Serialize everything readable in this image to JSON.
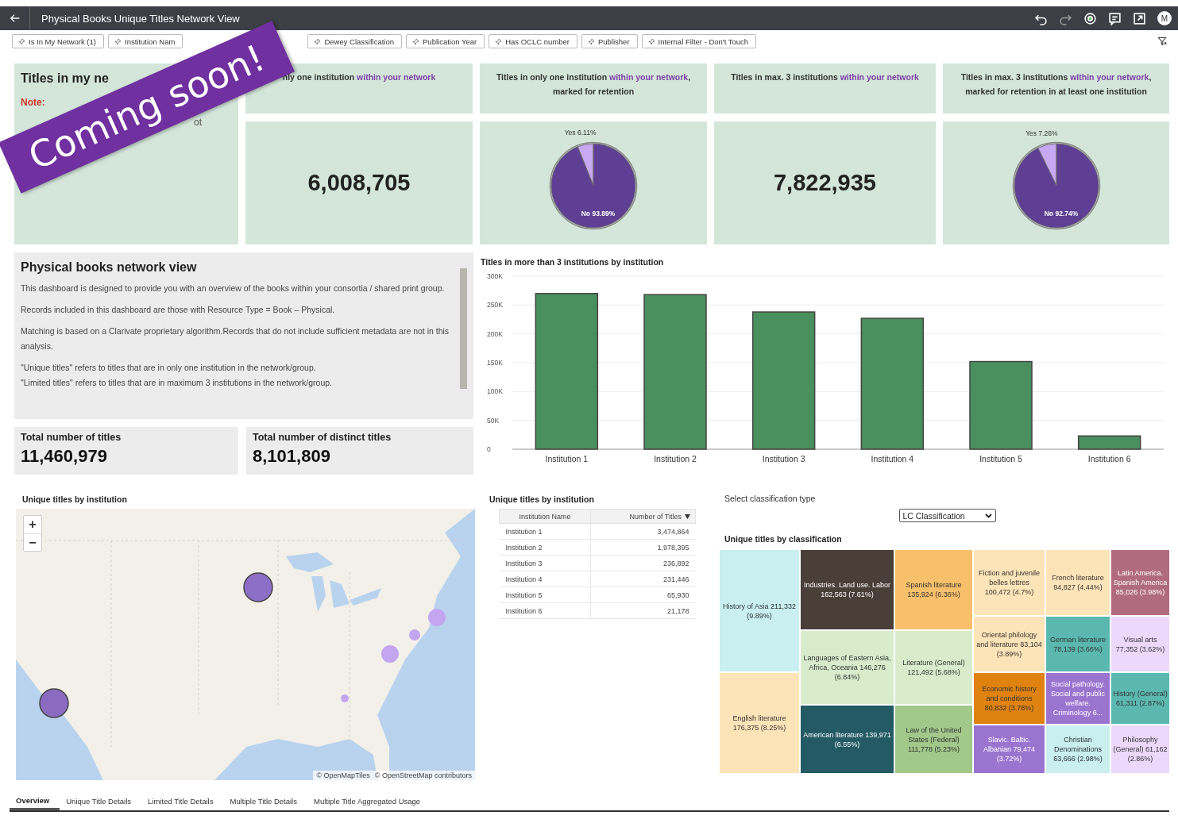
{
  "window": {
    "title": "Physical Books Unique Titles Network View",
    "avatar": "M"
  },
  "filters": [
    {
      "label": "Is In My Network (1)"
    },
    {
      "label": "Institution Nam"
    },
    {
      "label": "Dewey Classification"
    },
    {
      "label": "Publication Year"
    },
    {
      "label": "Has OCLC number"
    },
    {
      "label": "Publisher"
    },
    {
      "label": "Internal Filter - Don't Touch"
    }
  ],
  "summary_card": {
    "title": "Titles in my ne",
    "note_label": "Note:",
    "note_fragment": "ot"
  },
  "kpis": [
    {
      "kind": "number",
      "title": "nly one institution",
      "highlight": "within your network",
      "value": "6,008,705"
    },
    {
      "kind": "pie",
      "title": "Titles in only one institution",
      "highlight": "within your network",
      "title_end": ", marked for retention",
      "chart_data": {
        "type": "pie",
        "categories": [
          "Yes",
          "No"
        ],
        "values": [
          6.11,
          93.89
        ],
        "value_labels": [
          "6.11%",
          "93.89%"
        ]
      }
    },
    {
      "kind": "number",
      "title": "Titles in max. 3 institutions",
      "highlight": "within your network",
      "value": "7,822,935"
    },
    {
      "kind": "pie",
      "title": "Titles in max. 3 institutions",
      "highlight": "within your network",
      "title_end": ", marked for retention in at least one institution",
      "chart_data": {
        "type": "pie",
        "categories": [
          "Yes",
          "No"
        ],
        "values": [
          7.26,
          92.74
        ],
        "value_labels": [
          "7.26%",
          "92.74%"
        ]
      }
    }
  ],
  "info": {
    "title": "Physical books network view",
    "paragraphs": [
      "This dashboard is designed to provide you with an overview of the books within your consortia / shared print group.",
      "Records included in this dashboard are those with Resource Type = Book – Physical.",
      "Matching is based on a Clarivate proprietary algorithm.Records that do not include sufficient metadata are not in this analysis.",
      "\"Unique titles\" refers to titles that are in only one institution in the network/group.",
      "\"Limited titles\" refers to titles that are in maximum 3 institutions in the network/group."
    ]
  },
  "totals": [
    {
      "label": "Total number of titles",
      "value": "11,460,979"
    },
    {
      "label": "Total number of distinct titles",
      "value": "8,101,809"
    }
  ],
  "bar_chart": {
    "chart_data": {
      "type": "bar",
      "title": "Titles in more than 3 institutions by institution",
      "categories": [
        "Institution 1",
        "Institution 2",
        "Institution 3",
        "Institution 4",
        "Institution 5",
        "Institution 6"
      ],
      "grid": true,
      "series": [
        {
          "color": "#4a8f5e",
          "values": [
            270000,
            268000,
            238000,
            227000,
            152000,
            23000
          ]
        }
      ],
      "ylim": [
        0,
        300000
      ],
      "yticks": [
        {
          "value": 0,
          "label": "0"
        },
        {
          "value": 50000,
          "label": "50K"
        },
        {
          "value": 100000,
          "label": "100K"
        },
        {
          "value": 150000,
          "label": "150K"
        },
        {
          "value": 200000,
          "label": "200K"
        },
        {
          "value": 250000,
          "label": "250K"
        },
        {
          "value": 300000,
          "label": "300K"
        }
      ]
    }
  },
  "map": {
    "title": "Unique titles by institution",
    "zoom_in": "+",
    "zoom_out": "−",
    "attribution": [
      "© OpenMapTiles",
      "© OpenStreetMap contributors"
    ]
  },
  "table": {
    "title": "Unique titles by institution",
    "columns": [
      {
        "label": "Institution Name"
      },
      {
        "label": "Number of Titles",
        "sorted": true
      }
    ],
    "rows": [
      [
        "Institution 1",
        "3,474,864"
      ],
      [
        "Institution 2",
        "1,978,395"
      ],
      [
        "Institution 3",
        "236,892"
      ],
      [
        "Institution 4",
        "231,446"
      ],
      [
        "Institution 5",
        "65,930"
      ],
      [
        "Institution 6",
        "21,178"
      ]
    ]
  },
  "classification": {
    "label": "Select classification type",
    "value": "LC Classification"
  },
  "treemap": {
    "title": "Unique titles by classification",
    "tiles": [
      {
        "label": "History of Asia 211,332 (9.89%)",
        "color": "#c9eff0"
      },
      {
        "label": "English literature 176,375 (8.25%)",
        "color": "#fde4b8"
      },
      {
        "label": "Industries. Land use. Labor 162,563 (7.61%)",
        "color": "#4a3f38"
      },
      {
        "label": "Languages of Eastern Asia, Africa, Oceania 146,276 (6.84%)",
        "color": "#d8eccc"
      },
      {
        "label": "American literature 139,971 (6.55%)",
        "color": "#235a63"
      },
      {
        "label": "Spanish literature 135,924 (6.36%)",
        "color": "#f8c06a"
      },
      {
        "label": "Literature (General) 121,492 (5.68%)",
        "color": "#d8eccc"
      },
      {
        "label": "Law of the United States (Federal) 111,778 (5.23%)",
        "color": "#a2c98a"
      },
      {
        "label": "Fiction and juvenile belles lettres 100,472 (4.7%)",
        "color": "#fde4b8"
      },
      {
        "label": "French literature 94,827 (4.44%)",
        "color": "#fde4b8"
      },
      {
        "label": "Latin America. Spanish America 85,026 (3.98%)",
        "color": "#b06b7e"
      },
      {
        "label": "Oriental philology and literature 83,104 (3.89%)",
        "color": "#fde4b8"
      },
      {
        "label": "German literature 78,139 (3.66%)",
        "color": "#5bb8b0"
      },
      {
        "label": "Visual arts 77,352 (3.62%)",
        "color": "#ecd8fb"
      },
      {
        "label": "Economic history and conditions 80,832 (3.78%)",
        "color": "#e0820f"
      },
      {
        "label": "Social pathology. Social and public welfare. Criminology 6...",
        "color": "#9b74d0"
      },
      {
        "label": "History (General) 61,311 (2.87%)",
        "color": "#5bb8b0"
      },
      {
        "label": "Slavic. Baltic. Albanian 79,474 (3.72%)",
        "color": "#9b74d0"
      },
      {
        "label": "Christian Denominations 63,666 (2.98%)",
        "color": "#c9eff0"
      },
      {
        "label": "Philosophy (General) 61,162 (2.86%)",
        "color": "#ecd8fb"
      }
    ]
  },
  "tabs": [
    {
      "label": "Overview",
      "selected": true
    },
    {
      "label": "Unique Title Details",
      "selected": false
    },
    {
      "label": "Limited Title Details",
      "selected": false
    },
    {
      "label": "Multiple Title Details",
      "selected": false
    },
    {
      "label": "Multiple Title Aggregated Usage",
      "selected": false
    }
  ],
  "banner": {
    "text": "Coming soon!"
  }
}
